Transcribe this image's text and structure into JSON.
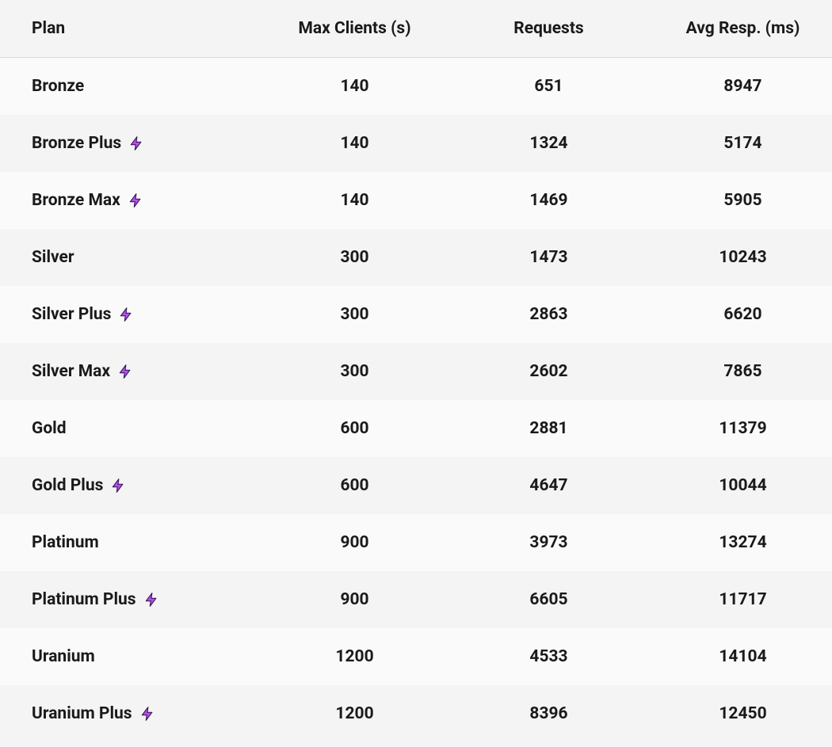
{
  "table": {
    "headers": {
      "plan": "Plan",
      "max_clients": "Max Clients (s)",
      "requests": "Requests",
      "avg_resp": "Avg Resp. (ms)"
    },
    "rows": [
      {
        "plan": "Bronze",
        "bolt": false,
        "max_clients": "140",
        "requests": "651",
        "avg_resp": "8947"
      },
      {
        "plan": "Bronze Plus",
        "bolt": true,
        "max_clients": "140",
        "requests": "1324",
        "avg_resp": "5174"
      },
      {
        "plan": "Bronze Max",
        "bolt": true,
        "max_clients": "140",
        "requests": "1469",
        "avg_resp": "5905"
      },
      {
        "plan": "Silver",
        "bolt": false,
        "max_clients": "300",
        "requests": "1473",
        "avg_resp": "10243"
      },
      {
        "plan": "Silver Plus",
        "bolt": true,
        "max_clients": "300",
        "requests": "2863",
        "avg_resp": "6620"
      },
      {
        "plan": "Silver Max",
        "bolt": true,
        "max_clients": "300",
        "requests": "2602",
        "avg_resp": "7865"
      },
      {
        "plan": "Gold",
        "bolt": false,
        "max_clients": "600",
        "requests": "2881",
        "avg_resp": "11379"
      },
      {
        "plan": "Gold Plus",
        "bolt": true,
        "max_clients": "600",
        "requests": "4647",
        "avg_resp": "10044"
      },
      {
        "plan": "Platinum",
        "bolt": false,
        "max_clients": "900",
        "requests": "3973",
        "avg_resp": "13274"
      },
      {
        "plan": "Platinum Plus",
        "bolt": true,
        "max_clients": "900",
        "requests": "6605",
        "avg_resp": "11717"
      },
      {
        "plan": "Uranium",
        "bolt": false,
        "max_clients": "1200",
        "requests": "4533",
        "avg_resp": "14104"
      },
      {
        "plan": "Uranium Plus",
        "bolt": true,
        "max_clients": "1200",
        "requests": "8396",
        "avg_resp": "12450"
      }
    ]
  },
  "icons": {
    "bolt": "lightning-bolt-icon"
  },
  "chart_data": {
    "type": "table",
    "columns": [
      "Plan",
      "Max Clients (s)",
      "Requests",
      "Avg Resp. (ms)"
    ],
    "data": [
      [
        "Bronze",
        140,
        651,
        8947
      ],
      [
        "Bronze Plus",
        140,
        1324,
        5174
      ],
      [
        "Bronze Max",
        140,
        1469,
        5905
      ],
      [
        "Silver",
        300,
        1473,
        10243
      ],
      [
        "Silver Plus",
        300,
        2863,
        6620
      ],
      [
        "Silver Max",
        300,
        2602,
        7865
      ],
      [
        "Gold",
        600,
        2881,
        11379
      ],
      [
        "Gold Plus",
        600,
        4647,
        10044
      ],
      [
        "Platinum",
        900,
        3973,
        13274
      ],
      [
        "Platinum Plus",
        900,
        6605,
        11717
      ],
      [
        "Uranium",
        1200,
        4533,
        14104
      ],
      [
        "Uranium Plus",
        1200,
        8396,
        12450
      ]
    ]
  }
}
